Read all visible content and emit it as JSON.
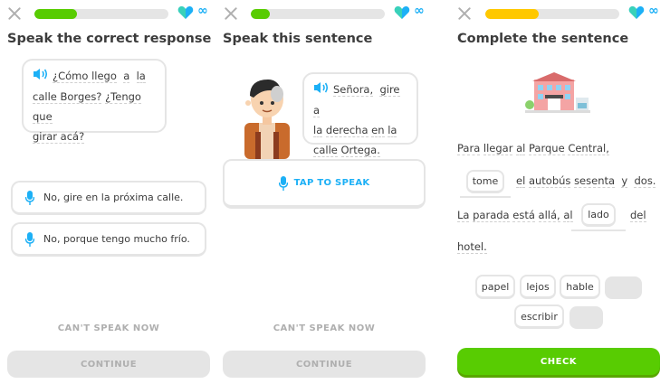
{
  "colors": {
    "green": "#58cc02",
    "yellow": "#ffc800",
    "blue": "#1cb0f6",
    "gray": "#e5e5e5"
  },
  "panel1": {
    "progress": 0.32,
    "infinity": "∞",
    "title": "Speak the correct response",
    "bubble": [
      "¿Cómo llego",
      "a",
      "la",
      "calle Borges?",
      "¿Tengo que",
      "girar acá?"
    ],
    "options": [
      "No, gire en la próxima calle.",
      "No, porque tengo mucho frío."
    ],
    "cant_speak": "CAN'T SPEAK NOW",
    "continue": "CONTINUE"
  },
  "panel2": {
    "progress": 0.14,
    "infinity": "∞",
    "title": "Speak this sentence",
    "bubble": [
      "Señora,",
      "gire",
      "a",
      "la",
      "derecha",
      "en",
      "la",
      "calle",
      "Ortega."
    ],
    "tap_to_speak": "TAP TO SPEAK",
    "cant_speak": "CAN'T SPEAK NOW",
    "continue": "CONTINUE"
  },
  "panel3": {
    "progress": 0.4,
    "infinity": "∞",
    "title": "Complete the sentence",
    "line1": [
      "Para",
      "llegar",
      "al",
      "Parque",
      "Central,"
    ],
    "blank1": "tome",
    "line2": [
      "el",
      "autobús",
      "sesenta",
      "y",
      "dos."
    ],
    "line3": [
      "La",
      "parada",
      "está",
      "allá,",
      "al"
    ],
    "blank2": "lado",
    "line3b": "del",
    "line4": "hotel.",
    "bank": [
      "papel",
      "lejos",
      "hable",
      "escribir"
    ],
    "check": "CHECK"
  }
}
